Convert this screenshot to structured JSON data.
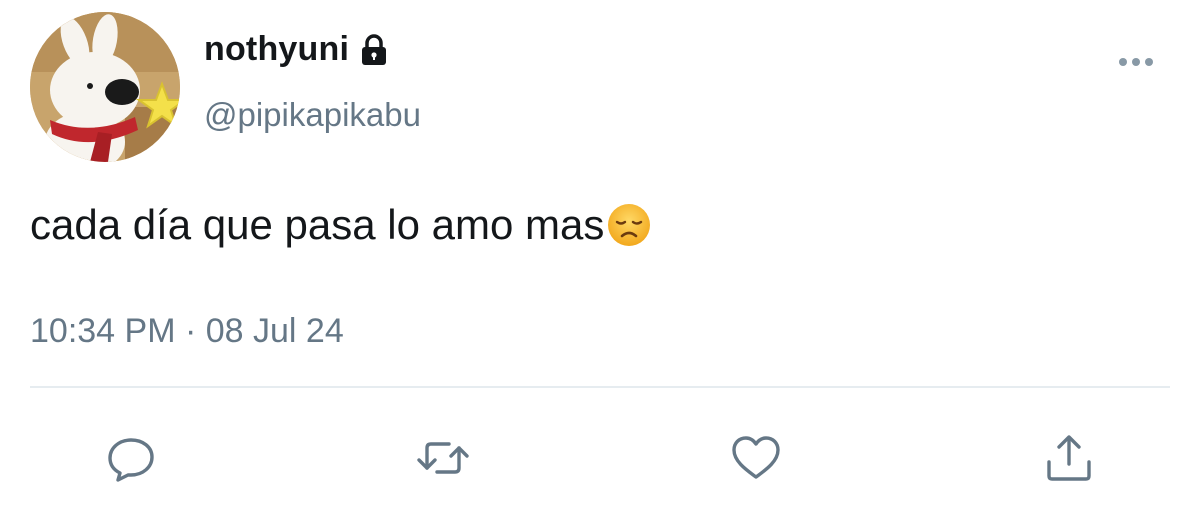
{
  "user": {
    "display_name": "nothyuni",
    "handle": "@pipikapikabu",
    "protected_icon": "lock-icon",
    "avatar": "cartoon-rabbit-with-star-avatar"
  },
  "tweet": {
    "text": "cada día que pasa lo amo mas",
    "emoji": "disappointed-face-emoji",
    "timestamp": "10:34 PM · 08 Jul 24"
  },
  "actions": [
    {
      "icon": "reply-icon"
    },
    {
      "icon": "retweet-icon"
    },
    {
      "icon": "like-icon"
    },
    {
      "icon": "share-icon"
    }
  ],
  "menu": {
    "icon": "more-options-icon"
  },
  "colors": {
    "primary_text": "#14171a",
    "secondary_text": "#657786",
    "divider": "#e6ecf0"
  }
}
